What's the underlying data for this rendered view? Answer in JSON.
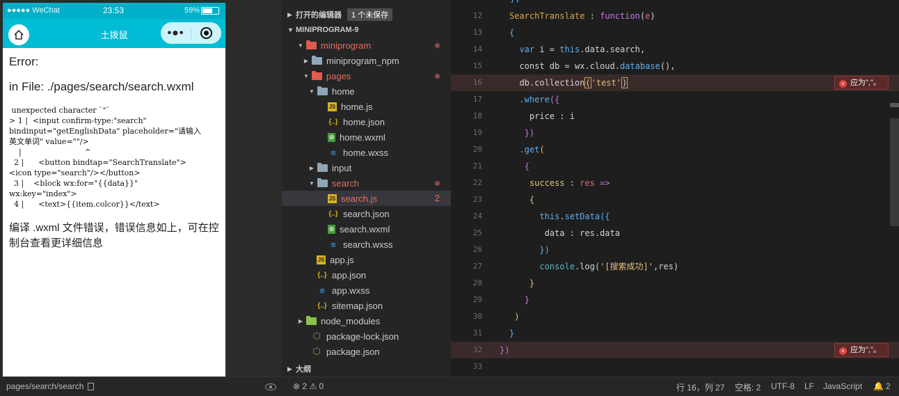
{
  "simulator": {
    "status_bar": {
      "carrier": "●●●●● WeChat",
      "time": "23:53",
      "battery": "59%"
    },
    "nav_title": "土拨鼠",
    "capsule_more": "•●•",
    "error": {
      "title": "Error:",
      "file": "in File: ./pages/search/search.wxml",
      "detail": " unexpected character `\"`\n> 1 |  <input confirm-type:\"search\"\nbindinput=\"getEnglishData\" placeholder=\"请输入\n英文单词\" value=\"\"/>\n    |                          ^\n  2 |      <button bindtap=\"SearchTranslate\">\n<icon type=\"search\"/></button>\n  3 |    <block wx:for=\"{{data}}\"\nwx:key=\"index\">\n  4 |      <text>{{item.colcor}}</text>",
      "tip": "编译 .wxml 文件错误，错误信息如上，可在控制台查看更详细信息"
    },
    "footer_path": "pages/search/search"
  },
  "explorer": {
    "open_editors_label": "打开的编辑器",
    "unsaved_badge": "1 个未保存",
    "project_label": "MINIPROGRAM-9",
    "outline_label": "大纲",
    "tree": [
      {
        "name": "miniprogram",
        "icon": "folder-red",
        "depth": 1,
        "arrow": "down",
        "color": "red",
        "dot": true
      },
      {
        "name": "miniprogram_npm",
        "icon": "folder",
        "depth": 2,
        "arrow": "right"
      },
      {
        "name": "pages",
        "icon": "folder-red",
        "depth": 2,
        "arrow": "down",
        "color": "red",
        "dot": true
      },
      {
        "name": "home",
        "icon": "folder",
        "depth": 3,
        "arrow": "down"
      },
      {
        "name": "home.js",
        "icon": "js",
        "depth": 4
      },
      {
        "name": "home.json",
        "icon": "json",
        "depth": 4
      },
      {
        "name": "home.wxml",
        "icon": "wxml",
        "depth": 4
      },
      {
        "name": "home.wxss",
        "icon": "wxss",
        "depth": 4
      },
      {
        "name": "input",
        "icon": "folder",
        "depth": 3,
        "arrow": "right"
      },
      {
        "name": "search",
        "icon": "folder",
        "depth": 3,
        "arrow": "down",
        "color": "red",
        "dot": true
      },
      {
        "name": "search.js",
        "icon": "js",
        "depth": 4,
        "color": "red",
        "count": "2",
        "selected": true
      },
      {
        "name": "search.json",
        "icon": "json",
        "depth": 4
      },
      {
        "name": "search.wxml",
        "icon": "wxml",
        "depth": 4
      },
      {
        "name": "search.wxss",
        "icon": "wxss",
        "depth": 4
      },
      {
        "name": "app.js",
        "icon": "js",
        "depth": 3
      },
      {
        "name": "app.json",
        "icon": "json",
        "depth": 3
      },
      {
        "name": "app.wxss",
        "icon": "wxss",
        "depth": 3
      },
      {
        "name": "sitemap.json",
        "icon": "json",
        "depth": 3
      },
      {
        "name": "node_modules",
        "icon": "folder-green",
        "depth": 1,
        "arrow": "right"
      },
      {
        "name": "package-lock.json",
        "icon": "node",
        "depth": 2
      },
      {
        "name": "package.json",
        "icon": "node",
        "depth": 2
      }
    ]
  },
  "editor": {
    "error_hint": "应为\",\"。",
    "lines": [
      {
        "n": "12",
        "html": "<span class=\"fn\">SearchTranslate</span><span class=\"plain\"> : </span><span class=\"pur\">function</span><span class=\"plain\">(</span><span class=\"red\">e</span><span class=\"plain\">)</span>"
      },
      {
        "n": "13",
        "html": "<span class=\"kw\">{</span>"
      },
      {
        "n": "14",
        "html": "  <span class=\"kw\">var</span><span class=\"plain\"> i = </span><span class=\"kw\">this</span><span class=\"plain\">.data.search,</span>"
      },
      {
        "n": "15",
        "html": "  <span class=\"plain\">const db = wx.cloud.</span><span class=\"kw\">database</span><span class=\"plain\">(),</span>"
      },
      {
        "n": "16",
        "html": "  <span class=\"plain\">db.collection</span><span class=\"hl plain\">(</span><span class=\"str\">'test'</span><span class=\"hl plain\">)</span>",
        "error": true
      },
      {
        "n": "17",
        "html": "  <span class=\"kw\">.where</span><span class=\"pur\">({</span>"
      },
      {
        "n": "18",
        "html": "    <span class=\"plain\">price : i</span>"
      },
      {
        "n": "19",
        "html": "   <span class=\"pur\">})</span>"
      },
      {
        "n": "20",
        "html": "  <span class=\"kw\">.get</span><span class=\"yel\">(</span>"
      },
      {
        "n": "21",
        "html": "   <span class=\"pur\">{</span>"
      },
      {
        "n": "22",
        "html": "    <span class=\"yel\">success</span><span class=\"plain\"> : </span><span class=\"red\">res</span><span class=\"pur\"> =&gt;</span>"
      },
      {
        "n": "23",
        "html": "    <span class=\"yel\">{</span>"
      },
      {
        "n": "24",
        "html": "      <span class=\"kw\">this</span><span class=\"plain\">.</span><span class=\"kw\">setData</span><span class=\"kw\">({</span>"
      },
      {
        "n": "25",
        "html": "       <span class=\"plain\">data : res.data</span>"
      },
      {
        "n": "26",
        "html": "      <span class=\"kw\">})</span>"
      },
      {
        "n": "27",
        "html": "      <span class=\"cy\">console</span><span class=\"plain\">.log(</span><span class=\"str\">'[搜索成功]'</span><span class=\"plain\">,res)</span>"
      },
      {
        "n": "28",
        "html": "    <span class=\"yel\">}</span>"
      },
      {
        "n": "29",
        "html": "   <span class=\"pur\">}</span>"
      },
      {
        "n": "30",
        "html": " <span class=\"yel\">)</span>"
      },
      {
        "n": "31",
        "html": "<span class=\"kw\">}</span>"
      },
      {
        "n": "32",
        "html": "<span class=\"pur\">})</span>",
        "error": true,
        "shift": true
      },
      {
        "n": "33",
        "html": ""
      }
    ]
  },
  "statusbar": {
    "problems": "⊗ 2 ⚠ 0",
    "position": "行 16，列 27",
    "indent": "空格: 2",
    "encoding": "UTF-8",
    "eol": "LF",
    "language": "JavaScript",
    "notifications": "2"
  }
}
